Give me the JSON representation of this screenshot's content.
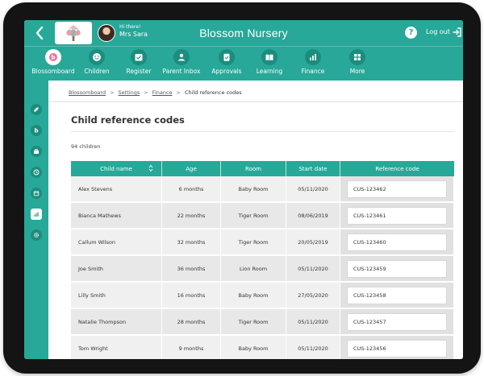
{
  "header": {
    "greeting": "Hi there!",
    "user_name": "Mrs Sara",
    "app_title": "Blossom Nursery",
    "help_label": "?",
    "logout_label": "Log out"
  },
  "nav": {
    "items": [
      {
        "label": "Blossomboard",
        "icon": "blossom-logo-icon",
        "active": true
      },
      {
        "label": "Children",
        "icon": "smile-icon"
      },
      {
        "label": "Register",
        "icon": "register-icon"
      },
      {
        "label": "Parent Inbox",
        "icon": "inbox-icon"
      },
      {
        "label": "Approvals",
        "icon": "clipboard-check-icon"
      },
      {
        "label": "Learning",
        "icon": "book-icon"
      },
      {
        "label": "Finance",
        "icon": "chart-icon"
      },
      {
        "label": "More",
        "icon": "grid-icon"
      }
    ]
  },
  "sidebar": {
    "icons": [
      "rocket-icon",
      "blossom-icon",
      "briefcase-icon",
      "clock-icon",
      "calendar-icon",
      "chart-icon",
      "settings-icon"
    ],
    "active_index": 5
  },
  "breadcrumb": {
    "items": [
      "Blossomboard",
      "Settings",
      "Finance"
    ],
    "current": "Child reference codes",
    "separator": ">"
  },
  "page": {
    "title": "Child reference codes",
    "count": "94 children"
  },
  "table": {
    "columns": [
      "Child name",
      "Age",
      "Room",
      "Start date",
      "Reference code"
    ],
    "rows": [
      {
        "name": "Alex Stevens",
        "age": "6 months",
        "room": "Baby Room",
        "start": "05/11/2020",
        "ref": "CUS-123462"
      },
      {
        "name": "Bianca Mathews",
        "age": "22 months",
        "room": "Tiger Room",
        "start": "08/06/2019",
        "ref": "CUS-123461"
      },
      {
        "name": "Callum Wilson",
        "age": "32 months",
        "room": "Tiger Room",
        "start": "20/05/2019",
        "ref": "CUS-123460"
      },
      {
        "name": "Joe Smith",
        "age": "36 months",
        "room": "Lion Room",
        "start": "05/11/2020",
        "ref": "CUS-123459"
      },
      {
        "name": "Lilly Smith",
        "age": "16 months",
        "room": "Baby Room",
        "start": "27/05/2020",
        "ref": "CUS-123458"
      },
      {
        "name": "Natalie Thompson",
        "age": "28 months",
        "room": "Tiger Room",
        "start": "05/11/2020",
        "ref": "CUS-123457"
      },
      {
        "name": "Tom Wright",
        "age": "9 months",
        "room": "Baby Room",
        "start": "05/11/2020",
        "ref": "CUS-123456"
      }
    ]
  },
  "colors": {
    "primary": "#27a898",
    "primary_dark": "#1d8c7e",
    "row_light": "#f0f0f0",
    "row_dark": "#e8e8e8"
  }
}
